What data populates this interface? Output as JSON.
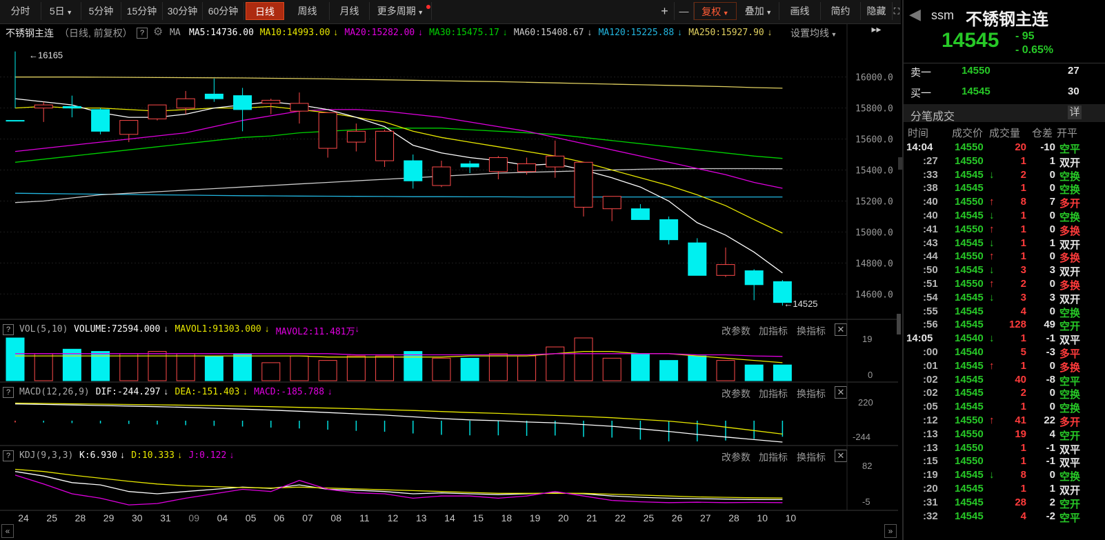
{
  "toolbar": {
    "periods": [
      "分时",
      "5日",
      "5分钟",
      "15分钟",
      "30分钟",
      "60分钟",
      "日线",
      "周线",
      "月线",
      "更多周期"
    ],
    "active_period": "日线",
    "right_tools": [
      "+",
      "—",
      "复权",
      "叠加",
      "画线",
      "简约",
      "隐藏"
    ]
  },
  "legend": {
    "name": "不锈钢主连",
    "mode": "（日线, 前复权）",
    "ma_label": "MA",
    "items": [
      {
        "text": "MA5:14736.00",
        "color": "#ffffff"
      },
      {
        "text": "MA10:14993.00",
        "color": "#e8e800"
      },
      {
        "text": "MA20:15282.00",
        "color": "#e000e0"
      },
      {
        "text": "MA30:15475.17",
        "color": "#00d000"
      },
      {
        "text": "MA60:15408.67",
        "color": "#cccccc"
      },
      {
        "text": "MA120:15225.88",
        "color": "#22b6e0"
      },
      {
        "text": "MA250:15927.90",
        "color": "#e0d060"
      }
    ],
    "settings": "设置均线"
  },
  "vol_legend": [
    {
      "text": "VOL(5,10)",
      "color": "#aaaaaa"
    },
    {
      "text": "VOLUME:72594.000",
      "color": "#ffffff"
    },
    {
      "text": "MAVOL1:91303.000",
      "color": "#e8e800"
    },
    {
      "text": "MAVOL2:11.481万",
      "color": "#e000e0"
    }
  ],
  "macd_legend": [
    {
      "text": "MACD(12,26,9)",
      "color": "#aaaaaa"
    },
    {
      "text": "DIF:-244.297",
      "color": "#ffffff"
    },
    {
      "text": "DEA:-151.403",
      "color": "#e8e800"
    },
    {
      "text": "MACD:-185.788",
      "color": "#e000e0"
    }
  ],
  "kdj_legend": [
    {
      "text": "KDJ(9,3,3)",
      "color": "#aaaaaa"
    },
    {
      "text": "K:6.930",
      "color": "#ffffff"
    },
    {
      "text": "D:10.333",
      "color": "#e8e800"
    },
    {
      "text": "J:0.122",
      "color": "#e000e0"
    }
  ],
  "sub_actions": [
    "改参数",
    "加指标",
    "换指标"
  ],
  "chart_data": {
    "type": "candlestick",
    "dates": [
      "24",
      "25",
      "28",
      "29",
      "30",
      "31",
      "09",
      "04",
      "05",
      "06",
      "07",
      "08",
      "11",
      "12",
      "13",
      "14",
      "15",
      "18",
      "19",
      "20",
      "21",
      "22",
      "25",
      "26",
      "27",
      "28",
      "10",
      "10"
    ],
    "ohlc": [
      [
        15720,
        16165,
        15800,
        15720
      ],
      [
        15800,
        15840,
        15710,
        15820
      ],
      [
        15810,
        15880,
        15740,
        15800
      ],
      [
        15790,
        15800,
        15630,
        15650
      ],
      [
        15630,
        15720,
        15580,
        15720
      ],
      [
        15730,
        15820,
        15720,
        15820
      ],
      [
        15800,
        15910,
        15760,
        15860
      ],
      [
        15890,
        15990,
        15840,
        15860
      ],
      [
        15880,
        15930,
        15650,
        15790
      ],
      [
        15830,
        15860,
        15760,
        15850
      ],
      [
        15780,
        15900,
        15700,
        15830
      ],
      [
        15540,
        15760,
        15480,
        15770
      ],
      [
        15580,
        15700,
        15520,
        15650
      ],
      [
        15460,
        15660,
        15420,
        15650
      ],
      [
        15460,
        15500,
        15280,
        15330
      ],
      [
        15300,
        15460,
        15290,
        15420
      ],
      [
        15440,
        15460,
        15380,
        15420
      ],
      [
        15390,
        15490,
        15340,
        15480
      ],
      [
        15390,
        15480,
        15370,
        15440
      ],
      [
        15420,
        15590,
        15350,
        15490
      ],
      [
        15160,
        15450,
        15100,
        15450
      ],
      [
        15150,
        15230,
        15070,
        15230
      ],
      [
        15150,
        15180,
        15100,
        15080
      ],
      [
        15080,
        15100,
        14920,
        14950
      ],
      [
        14930,
        14960,
        14720,
        14720
      ],
      [
        14720,
        14900,
        14710,
        14790
      ],
      [
        14750,
        14760,
        14560,
        14660
      ],
      [
        14680,
        14690,
        14525,
        14545
      ]
    ],
    "price_axis": [
      16000,
      15800,
      15600,
      15400,
      15200,
      15000,
      14800,
      14600
    ],
    "high_label": "16165",
    "low_label": "14525",
    "ma5": [
      15860,
      15840,
      15820,
      15770,
      15740,
      15740,
      15760,
      15800,
      15820,
      15840,
      15820,
      15790,
      15740,
      15680,
      15560,
      15510,
      15480,
      15460,
      15430,
      15440,
      15400,
      15350,
      15290,
      15200,
      15060,
      14980,
      14870,
      14736
    ],
    "ma10": [
      15800,
      15810,
      15800,
      15800,
      15790,
      15780,
      15790,
      15800,
      15800,
      15810,
      15790,
      15770,
      15740,
      15710,
      15650,
      15610,
      15580,
      15550,
      15520,
      15490,
      15450,
      15400,
      15350,
      15300,
      15240,
      15170,
      15080,
      14993
    ],
    "ma20": [
      15520,
      15540,
      15560,
      15580,
      15600,
      15620,
      15640,
      15680,
      15720,
      15750,
      15780,
      15790,
      15790,
      15780,
      15760,
      15740,
      15710,
      15680,
      15650,
      15610,
      15570,
      15530,
      15490,
      15450,
      15410,
      15370,
      15320,
      15282
    ],
    "ma30": [
      15450,
      15470,
      15490,
      15510,
      15530,
      15550,
      15570,
      15590,
      15610,
      15620,
      15640,
      15650,
      15660,
      15670,
      15670,
      15670,
      15660,
      15650,
      15640,
      15630,
      15610,
      15590,
      15570,
      15550,
      15530,
      15510,
      15490,
      15475
    ],
    "ma60": [
      15190,
      15200,
      15220,
      15240,
      15250,
      15260,
      15270,
      15280,
      15290,
      15300,
      15310,
      15320,
      15330,
      15340,
      15350,
      15360,
      15370,
      15380,
      15385,
      15390,
      15395,
      15400,
      15405,
      15408,
      15409,
      15409,
      15409,
      15408
    ],
    "ma120": [
      15250,
      15248,
      15246,
      15244,
      15242,
      15240,
      15238,
      15236,
      15234,
      15233,
      15232,
      15231,
      15230,
      15229,
      15228,
      15228,
      15227,
      15227,
      15226,
      15226,
      15226,
      15226,
      15226,
      15226,
      15226,
      15226,
      15226,
      15226
    ],
    "ma250": [
      16000,
      16000,
      16000,
      15999,
      15998,
      15997,
      15996,
      15995,
      15994,
      15992,
      15990,
      15988,
      15985,
      15982,
      15979,
      15976,
      15973,
      15970,
      15966,
      15962,
      15958,
      15954,
      15950,
      15946,
      15942,
      15938,
      15932,
      15928
    ],
    "volume": [
      19,
      12,
      14,
      13,
      12,
      13,
      12,
      11,
      12,
      8,
      11,
      9,
      11,
      11,
      13,
      10,
      10,
      12,
      11,
      15,
      19,
      10,
      12,
      9,
      11,
      9,
      7,
      7
    ],
    "vol_axis": [
      "19",
      "0"
    ],
    "vol_ma1": [
      11,
      11,
      11,
      11,
      11,
      11,
      11,
      11,
      11,
      11,
      11,
      10.5,
      10.5,
      10.5,
      10.5,
      10.5,
      11,
      11,
      11,
      12,
      13,
      13,
      12,
      12,
      11,
      10,
      9,
      8
    ],
    "vol_ma2": [
      12,
      12,
      12,
      12,
      12,
      12,
      12,
      12,
      12,
      12,
      12,
      12,
      11.5,
      11.5,
      11.5,
      11.5,
      11.5,
      11.5,
      11.5,
      12,
      12,
      12,
      12,
      12,
      11.5,
      11.5,
      11,
      10.8
    ],
    "macd_axis": [
      "220",
      "-244"
    ],
    "macd_dif": [
      200,
      195,
      188,
      182,
      175,
      168,
      160,
      150,
      140,
      128,
      115,
      100,
      85,
      70,
      50,
      30,
      15,
      5,
      -10,
      -20,
      -40,
      -60,
      -90,
      -120,
      -155,
      -185,
      -215,
      -244
    ],
    "macd_dea": [
      210,
      206,
      202,
      198,
      194,
      190,
      186,
      180,
      174,
      168,
      160,
      152,
      144,
      134,
      124,
      112,
      100,
      90,
      78,
      66,
      54,
      40,
      20,
      0,
      -30,
      -70,
      -110,
      -151
    ],
    "macd_hist": [
      -20,
      -22,
      -28,
      -32,
      -38,
      -44,
      -52,
      -60,
      -68,
      -80,
      -90,
      -104,
      -118,
      -128,
      -148,
      -164,
      -170,
      -170,
      -176,
      -172,
      -188,
      -196,
      -220,
      -240,
      -250,
      -230,
      -210,
      -186
    ],
    "kdj_axis": [
      "82",
      "-5"
    ],
    "kdj_k": [
      70,
      60,
      45,
      40,
      25,
      20,
      25,
      30,
      35,
      32,
      40,
      30,
      28,
      25,
      20,
      22,
      20,
      18,
      20,
      22,
      20,
      15,
      12,
      10,
      9,
      8,
      7,
      6.93
    ],
    "kdj_d": [
      75,
      70,
      62,
      55,
      48,
      42,
      38,
      36,
      34,
      33,
      35,
      33,
      31,
      29,
      27,
      25,
      23,
      21,
      21,
      21,
      21,
      19,
      17,
      15,
      13,
      12,
      11,
      10.333
    ],
    "kdj_j": [
      62,
      42,
      20,
      10,
      -5,
      -2,
      10,
      20,
      30,
      25,
      50,
      30,
      22,
      20,
      10,
      15,
      15,
      10,
      15,
      25,
      15,
      5,
      2,
      0,
      1,
      0,
      0.5,
      0.122
    ]
  },
  "right_panel": {
    "code": "ssm",
    "name": "不锈钢主连",
    "price": "14545",
    "change": "- 95",
    "change_pct": "- 0.65%",
    "sell1": {
      "label": "卖一",
      "price": "14550",
      "vol": "27"
    },
    "buy1": {
      "label": "买一",
      "price": "14545",
      "vol": "30"
    },
    "section": "分笔成交",
    "detail": "详",
    "columns": [
      "时间",
      "成交价",
      "成交量",
      "仓差",
      "开平"
    ],
    "ticks": [
      {
        "t": "14:04",
        "p": "14550",
        "a": "",
        "v": "20",
        "d": "-10",
        "k": "空平"
      },
      {
        "t": ":27",
        "p": "14550",
        "a": "",
        "v": "1",
        "d": "1",
        "k": "双开"
      },
      {
        "t": ":33",
        "p": "14545",
        "a": "↓",
        "v": "2",
        "d": "0",
        "k": "空换"
      },
      {
        "t": ":38",
        "p": "14545",
        "a": "",
        "v": "1",
        "d": "0",
        "k": "空换"
      },
      {
        "t": ":40",
        "p": "14550",
        "a": "↑",
        "v": "8",
        "d": "7",
        "k": "多开"
      },
      {
        "t": ":40",
        "p": "14545",
        "a": "↓",
        "v": "1",
        "d": "0",
        "k": "空换"
      },
      {
        "t": ":41",
        "p": "14550",
        "a": "↑",
        "v": "1",
        "d": "0",
        "k": "多换"
      },
      {
        "t": ":43",
        "p": "14545",
        "a": "↓",
        "v": "1",
        "d": "1",
        "k": "双开"
      },
      {
        "t": ":44",
        "p": "14550",
        "a": "↑",
        "v": "1",
        "d": "0",
        "k": "多换"
      },
      {
        "t": ":50",
        "p": "14545",
        "a": "↓",
        "v": "3",
        "d": "3",
        "k": "双开"
      },
      {
        "t": ":51",
        "p": "14550",
        "a": "↑",
        "v": "2",
        "d": "0",
        "k": "多换"
      },
      {
        "t": ":54",
        "p": "14545",
        "a": "↓",
        "v": "3",
        "d": "3",
        "k": "双开"
      },
      {
        "t": ":55",
        "p": "14545",
        "a": "",
        "v": "4",
        "d": "0",
        "k": "空换"
      },
      {
        "t": ":56",
        "p": "14545",
        "a": "",
        "v": "128",
        "d": "49",
        "k": "空开"
      },
      {
        "t": "14:05",
        "p": "14540",
        "a": "↓",
        "v": "1",
        "d": "-1",
        "k": "双平"
      },
      {
        "t": ":00",
        "p": "14540",
        "a": "",
        "v": "5",
        "d": "-3",
        "k": "多平"
      },
      {
        "t": ":01",
        "p": "14545",
        "a": "↑",
        "v": "1",
        "d": "0",
        "k": "多换"
      },
      {
        "t": ":02",
        "p": "14545",
        "a": "",
        "v": "40",
        "d": "-8",
        "k": "空平"
      },
      {
        "t": ":02",
        "p": "14545",
        "a": "",
        "v": "2",
        "d": "0",
        "k": "空换"
      },
      {
        "t": ":05",
        "p": "14545",
        "a": "",
        "v": "1",
        "d": "0",
        "k": "空换"
      },
      {
        "t": ":12",
        "p": "14550",
        "a": "↑",
        "v": "41",
        "d": "22",
        "k": "多开"
      },
      {
        "t": ":13",
        "p": "14550",
        "a": "",
        "v": "19",
        "d": "4",
        "k": "空开"
      },
      {
        "t": ":13",
        "p": "14550",
        "a": "",
        "v": "1",
        "d": "-1",
        "k": "双平"
      },
      {
        "t": ":15",
        "p": "14550",
        "a": "",
        "v": "1",
        "d": "-1",
        "k": "双平"
      },
      {
        "t": ":19",
        "p": "14545",
        "a": "↓",
        "v": "8",
        "d": "0",
        "k": "空换"
      },
      {
        "t": ":20",
        "p": "14545",
        "a": "",
        "v": "1",
        "d": "1",
        "k": "双开"
      },
      {
        "t": ":31",
        "p": "14545",
        "a": "",
        "v": "28",
        "d": "2",
        "k": "空开"
      },
      {
        "t": ":32",
        "p": "14545",
        "a": "",
        "v": "4",
        "d": "-2",
        "k": "空平"
      }
    ]
  }
}
